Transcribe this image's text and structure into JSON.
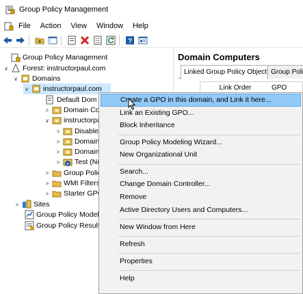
{
  "window": {
    "title": "Group Policy Management"
  },
  "menubar": {
    "items": [
      "File",
      "Action",
      "View",
      "Window",
      "Help"
    ]
  },
  "toolbar": {
    "buttons": [
      "back-arrow-icon",
      "forward-arrow-icon",
      "folder-up-icon",
      "show-hide-tree-icon",
      "properties-icon",
      "delete-icon",
      "export-icon",
      "refresh-icon",
      "help-icon",
      "console-icon"
    ]
  },
  "tree": {
    "root": "Group Policy Management",
    "forest": "Forest: instructorpaul.com",
    "domains": "Domains",
    "domain": "instructorpaul.com",
    "default_domain": "Default Dom",
    "domain_controllers": "Domain Con",
    "ou": "instructorpau",
    "disabled": "Disabled",
    "domain_a": "Domain",
    "domain_b": "Domain",
    "test": "Test (Nor",
    "gpo": "Group Policy",
    "wmi": "WMI Filters",
    "starter": "Starter GPOs",
    "sites": "Sites",
    "modeling": "Group Policy Model",
    "results": "Group Policy Result"
  },
  "right_pane": {
    "title": "Domain Computers",
    "tabs": [
      "Linked Group Policy Objects",
      "Group Policy"
    ],
    "columns": [
      "Link Order",
      "GPO"
    ]
  },
  "context_menu": {
    "items": [
      "Create a GPO in this domain, and Link it here...",
      "Link an Existing GPO...",
      "Block Inheritance",
      "Group Policy Modeling Wizard...",
      "New Organizational Unit",
      "Search...",
      "Change Domain Controller...",
      "Remove",
      "Active Directory Users and Computers...",
      "New Window from Here",
      "Refresh",
      "Properties",
      "Help"
    ],
    "highlighted": "Create a GPO in this domain, and Link it here..."
  },
  "colors": {
    "selection": "#cce8ff",
    "menu_highlight": "#91c9f7",
    "menu_bg": "#f2f2f2"
  }
}
